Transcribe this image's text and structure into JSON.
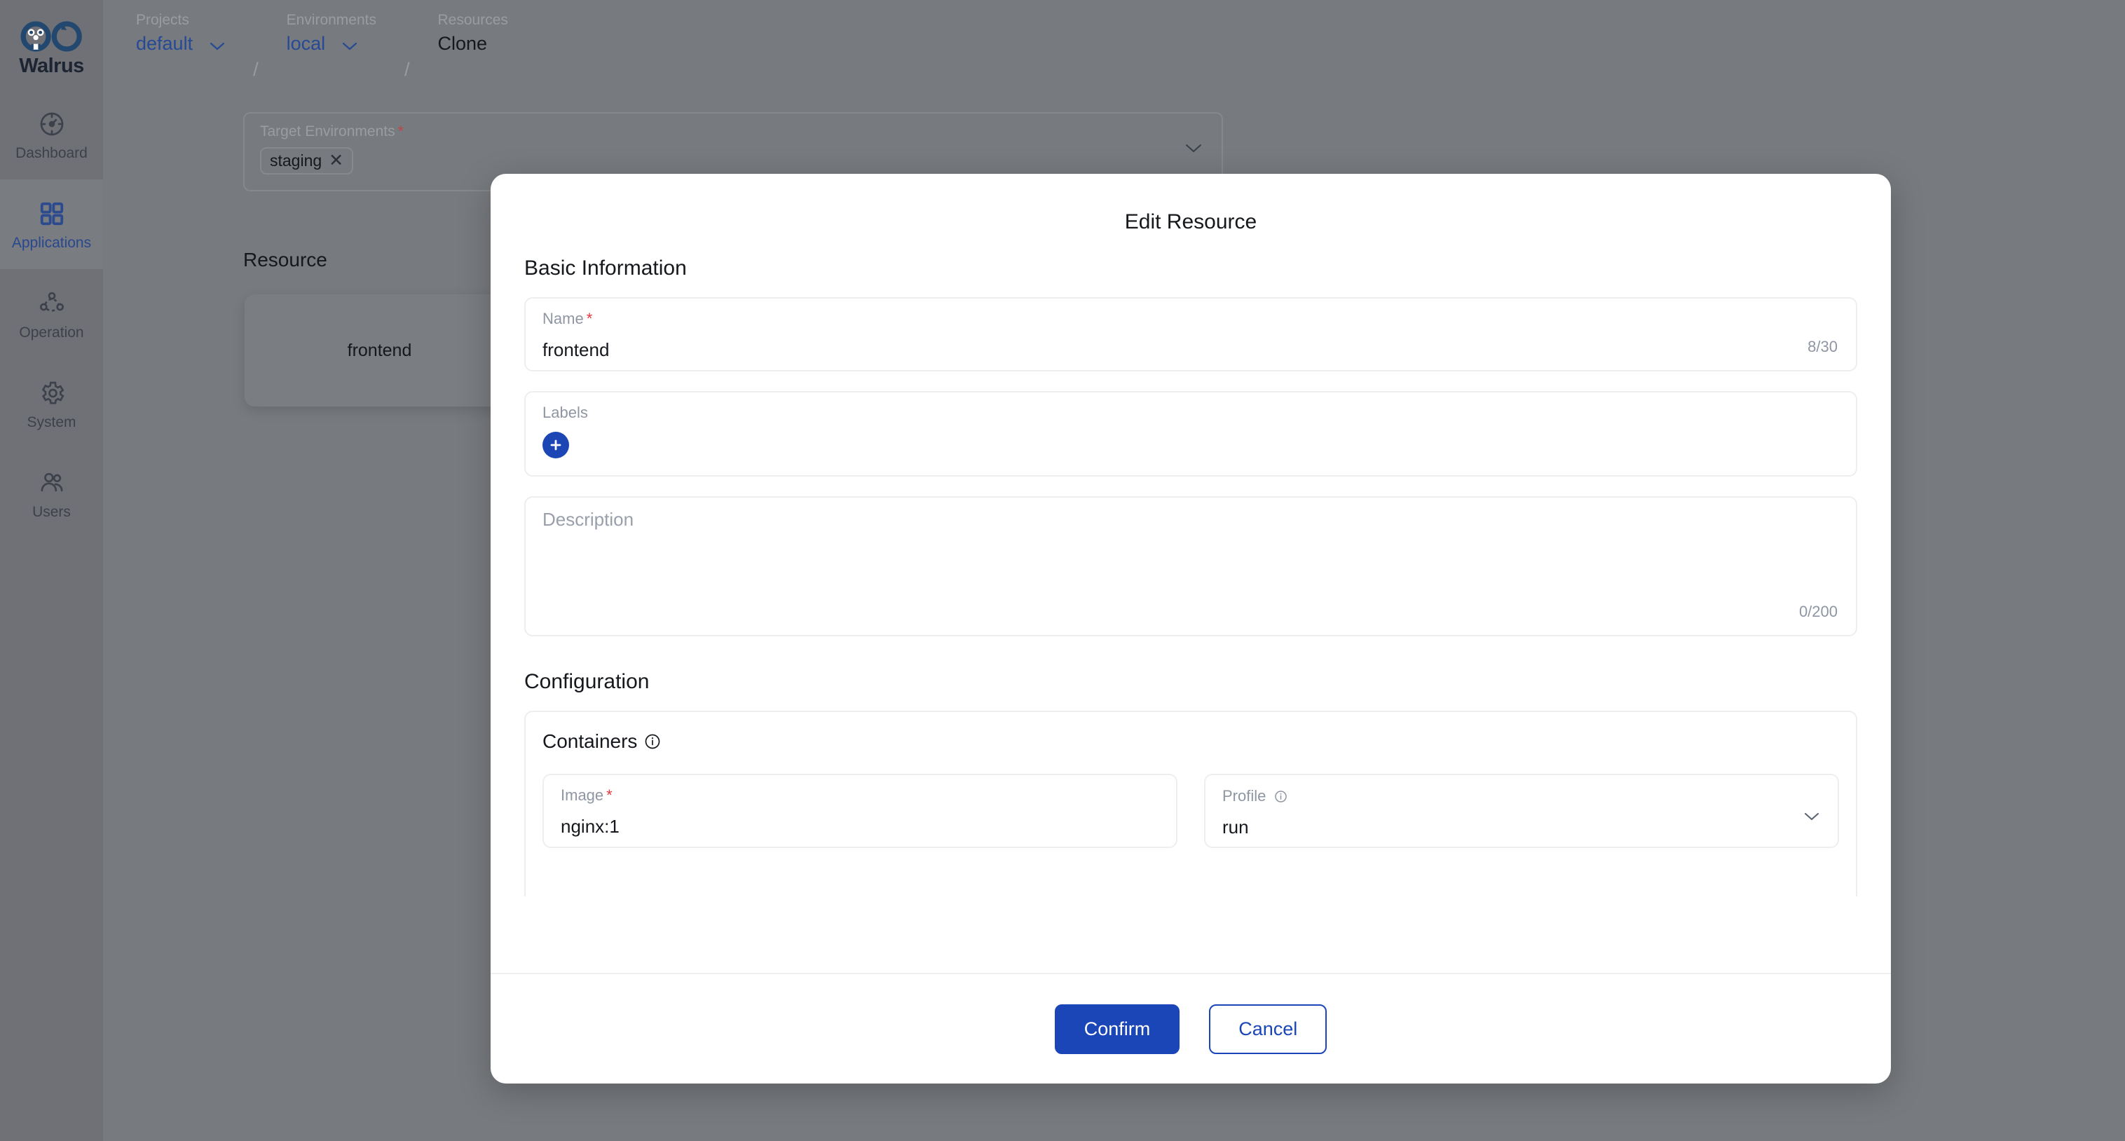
{
  "app": {
    "brand_name": "Walrus",
    "brand_logo_icon": "walrus-infinity-logo"
  },
  "sidebar": {
    "items": [
      {
        "label": "Dashboard",
        "icon": "gauge-icon",
        "active": false
      },
      {
        "label": "Applications",
        "icon": "grid-icon",
        "active": true
      },
      {
        "label": "Operation",
        "icon": "topology-icon",
        "active": false
      },
      {
        "label": "System",
        "icon": "gear-icon",
        "active": false
      },
      {
        "label": "Users",
        "icon": "users-icon",
        "active": false
      }
    ]
  },
  "breadcrumb": {
    "projects_caption": "Projects",
    "projects_value": "default",
    "separator_1": "/",
    "environments_caption": "Environments",
    "environments_value": "local",
    "separator_2": "/",
    "resources_caption": "Resources",
    "resources_value": "Clone"
  },
  "background": {
    "target_environments": {
      "label": "Target Environments",
      "required_marker": "*",
      "tags": [
        {
          "label": "staging",
          "remove_icon": "close-icon"
        }
      ],
      "dropdown_icon": "chevron-down-icon"
    },
    "resource_section_title": "Resource",
    "resource_cards": [
      {
        "label": "frontend"
      },
      {
        "label": ""
      }
    ]
  },
  "modal": {
    "title": "Edit Resource",
    "sections": {
      "basic_information": "Basic Information",
      "configuration": "Configuration"
    },
    "name_field": {
      "label": "Name",
      "required_marker": "*",
      "value": "frontend",
      "counter": "8/30"
    },
    "labels_field": {
      "label": "Labels",
      "add_icon": "plus-icon"
    },
    "description_field": {
      "placeholder": "Description",
      "value": "",
      "counter": "0/200"
    },
    "containers": {
      "title": "Containers",
      "info_icon": "info-circle-icon",
      "image_field": {
        "label": "Image",
        "required_marker": "*",
        "value": "nginx:1"
      },
      "profile_field": {
        "label": "Profile",
        "info_icon": "info-circle-icon",
        "value": "run",
        "dropdown_icon": "chevron-down-icon"
      }
    },
    "footer": {
      "confirm_label": "Confirm",
      "cancel_label": "Cancel"
    }
  },
  "colors": {
    "brand_blue": "#1A46B8",
    "link_blue": "#274A95",
    "required_red": "#E0393E",
    "overlay_gray": "#777A7E",
    "sidebar_gray": "#6F7176",
    "field_border": "#EDEEF0"
  }
}
